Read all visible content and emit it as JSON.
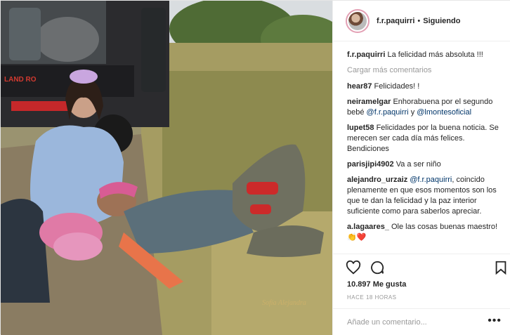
{
  "header": {
    "username": "f.r.paquirri",
    "separator": "•",
    "follow_status": "Siguiendo"
  },
  "caption": {
    "user": "f.r.paquirri",
    "text": "La felicidad más absoluta !!!"
  },
  "load_more": "Cargar más comentarios",
  "comments": [
    {
      "user": "hear87",
      "text": "Felicidades! !"
    },
    {
      "user": "neiramelgar",
      "text": "Enhorabuena por el segundo bebé",
      "mention1": "@f.r.paquirri",
      "mid": "y",
      "mention2": "@lmontesoficial"
    },
    {
      "user": "lupet58",
      "text": "Felicidades por la buena noticia. Se merecen ser cada día más felices. Bendiciones"
    },
    {
      "user": "parisjipi4902",
      "text": "Va a ser niño"
    },
    {
      "user": "alejandro_urzaiz",
      "mention1": "@f.r.paquirri",
      "text": ", coincido plenamente en que esos momentos son los que te dan la felicidad y la paz interior suficiente como para saberlos apreciar."
    },
    {
      "user": "a.lagaares_",
      "text": "Ole las cosas buenas maestro!👏❤️"
    }
  ],
  "likes": "10.897 Me gusta",
  "timestamp": "HACE 18 HORAS",
  "add_comment": {
    "placeholder": "Añade un comentario..."
  },
  "more_options": "•••",
  "photo": {
    "vehicle_text": "LAND RO",
    "watermark": "Sofía Alejandra"
  },
  "icons": {
    "like": "heart-icon",
    "comment": "comment-icon",
    "save": "bookmark-icon"
  },
  "colors": {
    "mention": "#003569",
    "muted": "#999999",
    "text": "#262626",
    "border": "#efefef"
  }
}
